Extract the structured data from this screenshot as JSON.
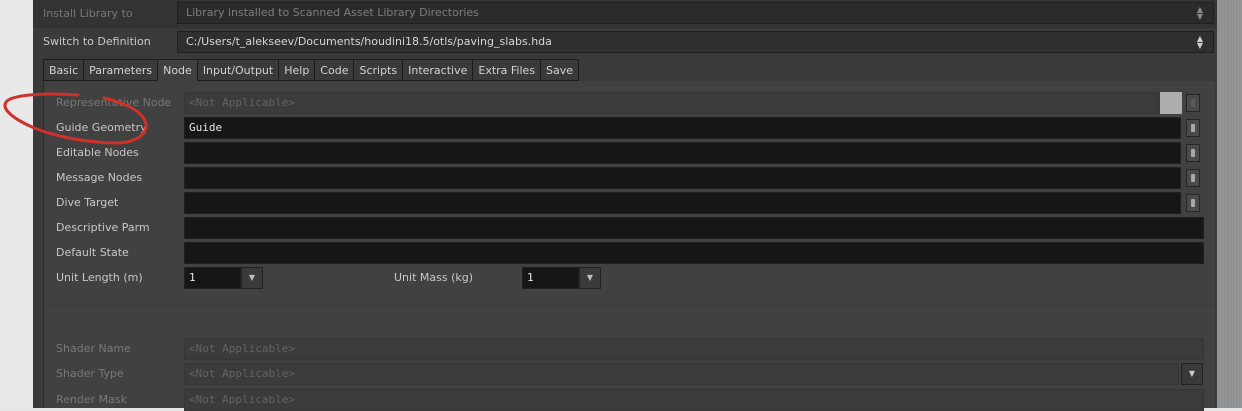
{
  "header": {
    "install_library_label": "Install Library to",
    "install_library_value": "Library installed to Scanned Asset Library Directories",
    "switch_definition_label": "Switch to Definition",
    "switch_definition_value": "C:/Users/t_alekseev/Documents/houdini18.5/otls/paving_slabs.hda"
  },
  "tabs": [
    "Basic",
    "Parameters",
    "Node",
    "Input/Output",
    "Help",
    "Code",
    "Scripts",
    "Interactive",
    "Extra Files",
    "Save"
  ],
  "active_tab": "Node",
  "node_tab": {
    "representative_node": {
      "label": "Representative Node",
      "value": "<Not Applicable>"
    },
    "guide_geometry": {
      "label": "Guide Geometry",
      "value": "Guide"
    },
    "editable_nodes": {
      "label": "Editable Nodes",
      "value": ""
    },
    "message_nodes": {
      "label": "Message Nodes",
      "value": ""
    },
    "dive_target": {
      "label": "Dive Target",
      "value": ""
    },
    "descriptive_parm": {
      "label": "Descriptive Parm",
      "value": ""
    },
    "default_state": {
      "label": "Default State",
      "value": ""
    },
    "unit_length": {
      "label": "Unit Length (m)",
      "value": "1"
    },
    "unit_mass": {
      "label": "Unit Mass (kg)",
      "value": "1"
    },
    "shader_name": {
      "label": "Shader Name",
      "value": "<Not Applicable>"
    },
    "shader_type": {
      "label": "Shader Type",
      "value": "<Not Applicable>"
    },
    "render_mask": {
      "label": "Render Mask",
      "value": "<Not Applicable>"
    }
  },
  "annotation": {
    "color": "#d0302a"
  }
}
